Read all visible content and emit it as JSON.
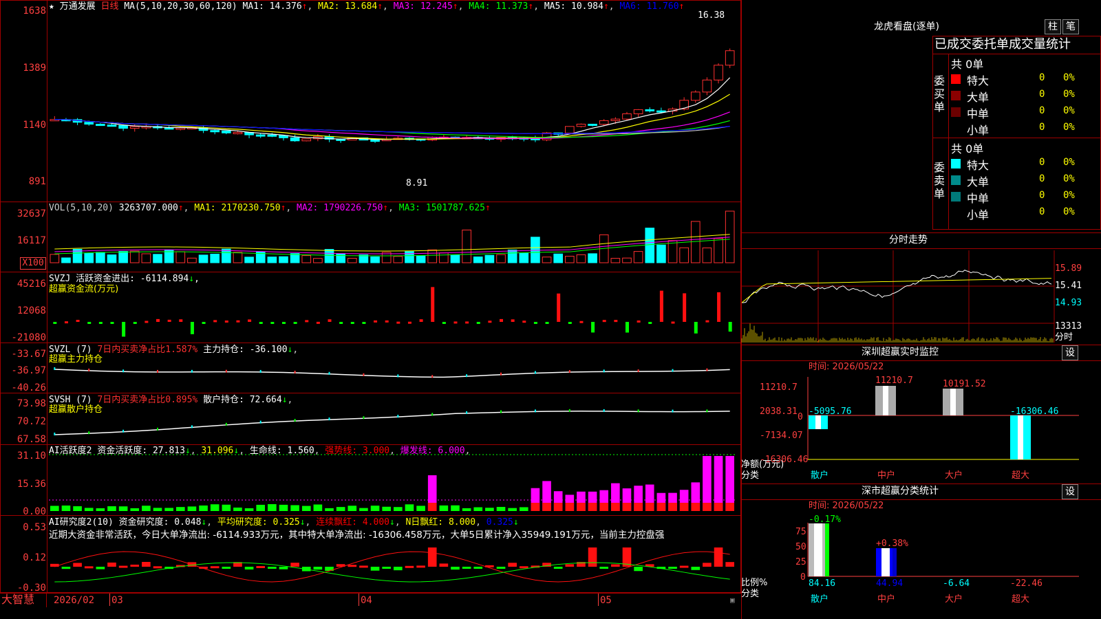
{
  "brand": "大智慧",
  "stock": {
    "name": "万通发展",
    "period": "日线",
    "ma_label": "MA(5,10,20,30,60,120)",
    "ma": [
      {
        "label": "MA1: 14.376",
        "color": "#ffffff"
      },
      {
        "label": "MA2: 13.684",
        "color": "#ffff00"
      },
      {
        "label": "MA3: 12.245",
        "color": "#ff00ff"
      },
      {
        "label": "MA4: 11.373",
        "color": "#00ff00"
      },
      {
        "label": "MA5: 10.984",
        "color": "#c0c0c0"
      },
      {
        "label": "MA6: 11.760",
        "color": "#0000ff"
      }
    ],
    "high_label": "16.38",
    "low_label": "8.91",
    "axis": [
      "1638",
      "1389",
      "1140",
      "891"
    ]
  },
  "vol": {
    "title": "VOL(5,10,20)",
    "value": "3263707.000",
    "ma1": "MA1: 2170230.750",
    "ma2": "MA2: 1790226.750",
    "ma3": "MA3: 1501787.625",
    "axis": [
      "32637",
      "16117"
    ],
    "unit": "X100"
  },
  "svzj": {
    "title": "SVZJ",
    "label": "活跃资金进出: -6114.894",
    "sub": "超赢资金流(万元)",
    "axis": [
      "45216",
      "12068",
      "-21080"
    ]
  },
  "svzl": {
    "title": "SVZL (7)",
    "ratio": "7日内买卖净占比1.587%",
    "hold": "主力持仓: -36.100",
    "sub": "超赢主力持仓",
    "axis": [
      "-33.67",
      "-36.97",
      "-40.26"
    ]
  },
  "svsh": {
    "title": "SVSH (7)",
    "ratio": "7日内买卖净占比0.895%",
    "hold": "散户持仓: 72.664",
    "sub": "超赢散户持仓",
    "axis": [
      "73.98",
      "70.72",
      "67.58"
    ]
  },
  "ai1": {
    "title": "AI活跃度2",
    "a": "资金活跃度: 27.813",
    "b": "31.096",
    "c": "生命线: 1.560",
    "d": "强势线: 3.000",
    "e": "爆发线: 6.000",
    "axis": [
      "31.10",
      "15.36",
      "0.00"
    ]
  },
  "ai2": {
    "title": "AI研究度2(10)",
    "a": "资金研究度: 0.048",
    "b": "平均研究度: 0.325",
    "c": "连续飘红: 4.000",
    "d": "N日飘红: 8.000",
    "e": "0.325",
    "note": "近期大资金非常活跃，今日大单净流出: -6114.933万元，其中特大单净流出: -16306.458万元，大单5日累计净入35949.191万元，当前主力控盘强",
    "axis": [
      "0.53",
      "0.12",
      "-0.30"
    ]
  },
  "dates": [
    "2026/02",
    "03",
    "04",
    "05"
  ],
  "lhb": {
    "title": "龙虎看盘(逐单)",
    "btn1": "柱",
    "btn2": "笔",
    "tabs": "已成交委托单成交量统计",
    "buy_label": "委买单",
    "sell_label": "委卖单",
    "buy_total": "共 0单",
    "sell_total": "共 0单",
    "rows": [
      "特大",
      "大单",
      "中单",
      "小单"
    ],
    "zero": "0",
    "pct": "0%",
    "buy_colors": [
      "#ff0000",
      "#8b0000",
      "#6b0000",
      "#000000"
    ],
    "sell_colors": [
      "#00ffff",
      "#008b8b",
      "#007a7a",
      "#000000"
    ]
  },
  "fenshi": {
    "title": "分时走势",
    "axis": [
      "15.89",
      "15.41",
      "14.93",
      "13313"
    ],
    "unit": "分时"
  },
  "sz1": {
    "title": "深圳超赢实时监控",
    "btn": "设",
    "time": "时间: 2026/05/22",
    "axis": [
      "11210.7",
      "2038.31",
      "0",
      "-7134.07",
      "-16306.46"
    ],
    "labels": [
      "-5095.76",
      "11210.7",
      "10191.52",
      "-16306.46"
    ],
    "cats": [
      "散户",
      "中户",
      "大户",
      "超大"
    ],
    "ylabel": "净额(万元)",
    "xlabel": "分类"
  },
  "sz2": {
    "title": "深市超赢分类统计",
    "btn": "设",
    "time": "时间: 2026/05/22",
    "axis": [
      "75",
      "50",
      "25",
      "0"
    ],
    "top_labels": [
      "-0.17%",
      "+0.38%"
    ],
    "bottom": [
      "84.16",
      "44.94",
      "-6.64",
      "-22.46"
    ],
    "cats": [
      "散户",
      "中户",
      "大户",
      "超大"
    ],
    "ylabel": "比例%",
    "xlabel": "分类"
  }
}
